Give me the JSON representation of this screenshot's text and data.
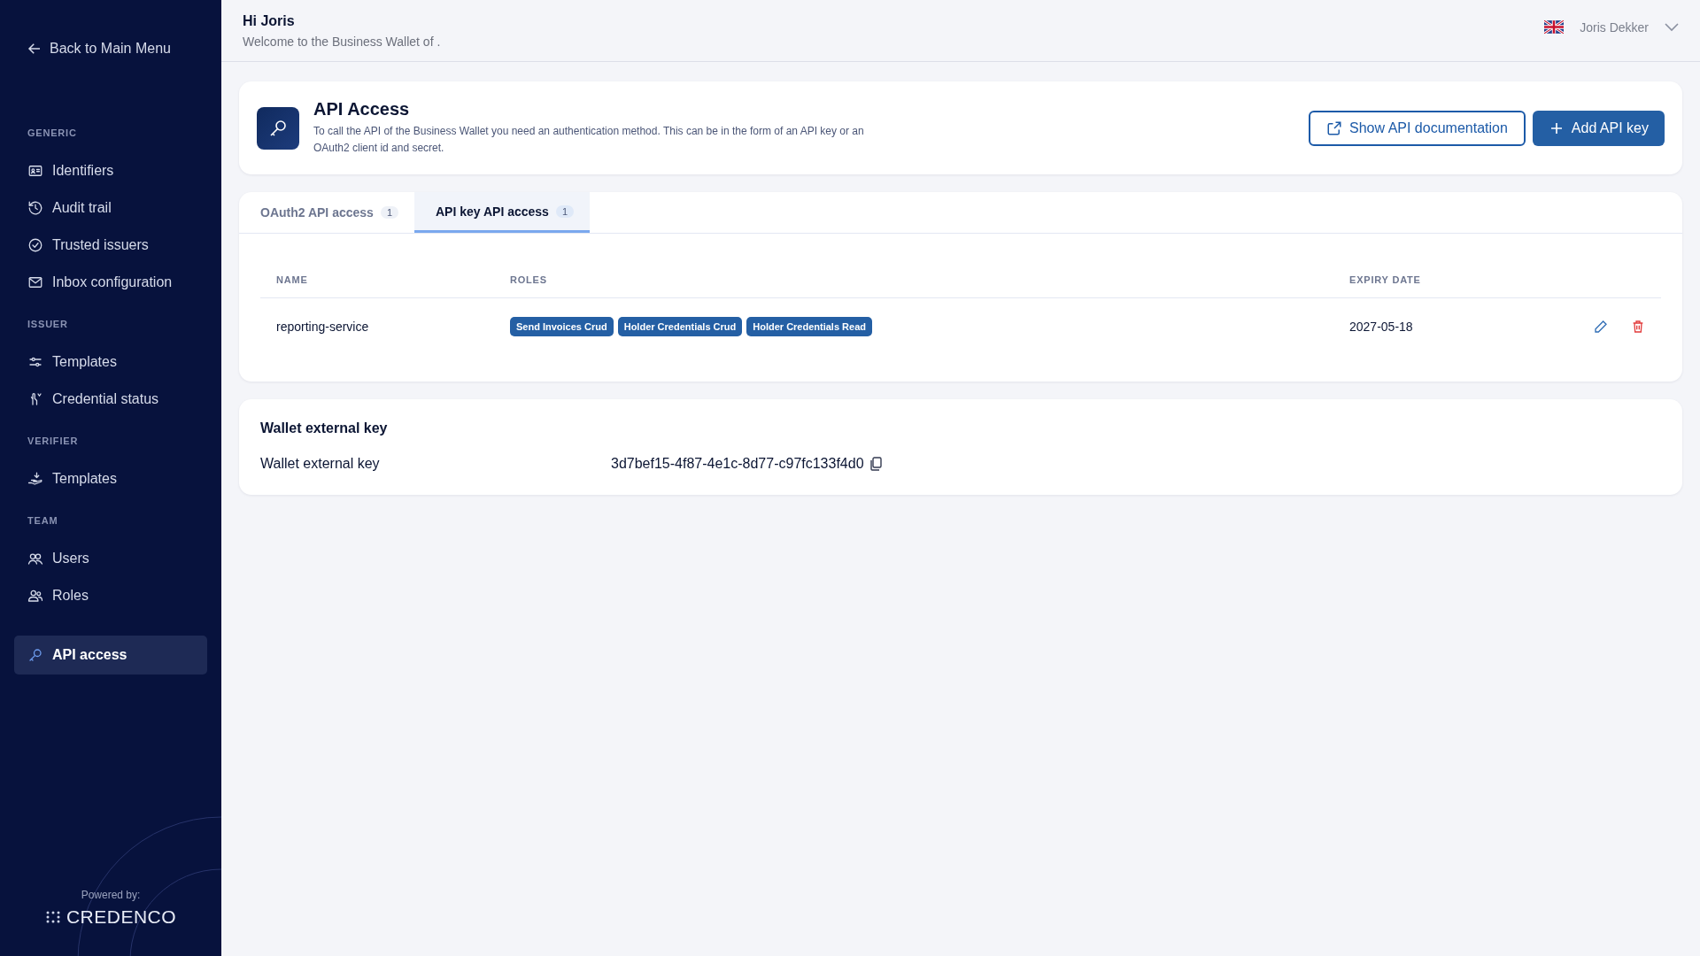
{
  "sidebar": {
    "back_link": "Back to Main Menu",
    "sections": [
      {
        "title": "GENERIC",
        "items": [
          {
            "label": "Identifiers",
            "kind": "idcard",
            "selected": false
          },
          {
            "label": "Audit trail",
            "kind": "history",
            "selected": false
          },
          {
            "label": "Trusted issuers",
            "kind": "badge",
            "selected": false
          },
          {
            "label": "Inbox configuration",
            "kind": "mail",
            "selected": false
          }
        ]
      },
      {
        "title": "ISSUER",
        "items": [
          {
            "label": "Templates",
            "kind": "sliders",
            "selected": false
          },
          {
            "label": "Credential status",
            "kind": "hand",
            "selected": false
          }
        ]
      },
      {
        "title": "VERIFIER",
        "items": [
          {
            "label": "Templates",
            "kind": "receive",
            "selected": false
          }
        ]
      },
      {
        "title": "TEAM",
        "items": [
          {
            "label": "Users",
            "kind": "users",
            "selected": false
          },
          {
            "label": "Roles",
            "kind": "roles",
            "selected": false
          }
        ]
      },
      {
        "items": [
          {
            "label": "API access",
            "kind": "key",
            "selected": true
          }
        ]
      }
    ],
    "powered_by": "Powered by:",
    "brand": "CREDENCO"
  },
  "header": {
    "greeting": "Hi Joris",
    "subtitle": "Welcome to the Business Wallet of .",
    "user": "Joris Dekker"
  },
  "page": {
    "title": "API Access",
    "description": "To call the API of the Business Wallet you need an authentication method. This can be in the form of an API key or an OAuth2 client id and secret.",
    "buttons": [
      {
        "label": "Show API documentation",
        "kind": "outline"
      },
      {
        "label": "Add API key",
        "kind": "primary"
      }
    ]
  },
  "tabs": [
    {
      "label": "OAuth2 API access",
      "count": "1",
      "selected": false
    },
    {
      "label": "API key API access",
      "count": "1",
      "selected": true
    }
  ],
  "table": {
    "columns": [
      "NAME",
      "ROLES",
      "EXPIRY DATE"
    ],
    "rows": [
      {
        "name": "reporting-service",
        "roles": [
          "Send Invoices Crud",
          "Holder Credentials Crud",
          "Holder Credentials Read"
        ],
        "expiry": "2027-05-18"
      }
    ]
  },
  "wallet_key": {
    "title": "Wallet external key",
    "label": "Wallet external key",
    "value": "3d7bef15-4f87-4e1c-8d77-c97fc133f4d0"
  }
}
